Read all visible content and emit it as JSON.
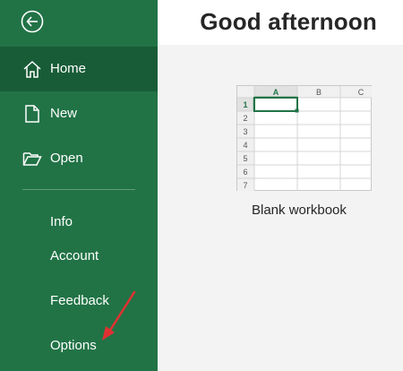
{
  "sidebar": {
    "back_icon": "back-arrow-icon",
    "nav_items": [
      {
        "label": "Home",
        "icon": "home-icon",
        "active": true
      },
      {
        "label": "New",
        "icon": "new-document-icon",
        "active": false
      },
      {
        "label": "Open",
        "icon": "open-folder-icon",
        "active": false
      }
    ],
    "text_items": [
      "Info",
      "Account",
      "Feedback",
      "Options"
    ],
    "bg_color": "#217346",
    "active_color": "#185c37"
  },
  "main": {
    "title": "Good afternoon",
    "new_tiles": [
      {
        "label": "Blank workbook",
        "columns": [
          "A",
          "B",
          "C"
        ],
        "rows": [
          "1",
          "2",
          "3",
          "4",
          "5",
          "6",
          "7"
        ]
      }
    ]
  },
  "annotation": {
    "arrow_color": "#e03131",
    "arrow_target": "Options"
  }
}
